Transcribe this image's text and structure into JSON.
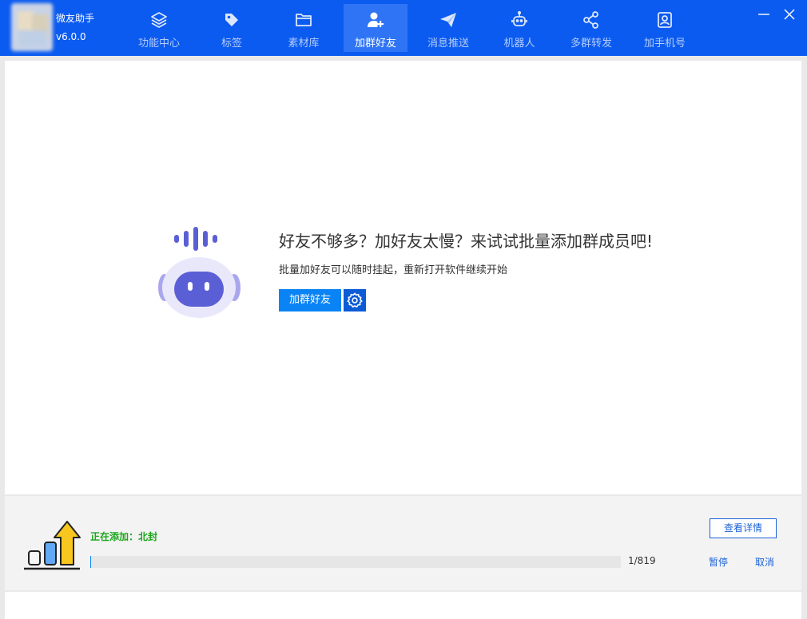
{
  "header": {
    "app_name": "微友助手",
    "version": "v6.0.0",
    "accent_color": "#0c5bf0",
    "nav": [
      {
        "label": "功能中心",
        "icon": "layers-icon",
        "active": false
      },
      {
        "label": "标签",
        "icon": "tag-icon",
        "active": false
      },
      {
        "label": "素材库",
        "icon": "folder-icon",
        "active": false
      },
      {
        "label": "加群好友",
        "icon": "add-user-icon",
        "active": true
      },
      {
        "label": "消息推送",
        "icon": "paper-plane-icon",
        "active": false
      },
      {
        "label": "机器人",
        "icon": "robot-icon",
        "active": false
      },
      {
        "label": "多群转发",
        "icon": "share-icon",
        "active": false
      },
      {
        "label": "加手机号",
        "icon": "contact-card-icon",
        "active": false
      }
    ]
  },
  "main": {
    "title": "好友不够多？加好友太慢？来试试批量添加群成员吧!",
    "subtitle": "批量加好友可以随时挂起，重新打开软件继续开始",
    "add_button_label": "加群好友",
    "settings_icon": "gear-icon"
  },
  "progress": {
    "status_text": "正在添加：北封",
    "count_text": "1/819",
    "current": 1,
    "total": 819,
    "details_button_label": "查看详情",
    "pause_label": "暂停",
    "cancel_label": "取消"
  }
}
